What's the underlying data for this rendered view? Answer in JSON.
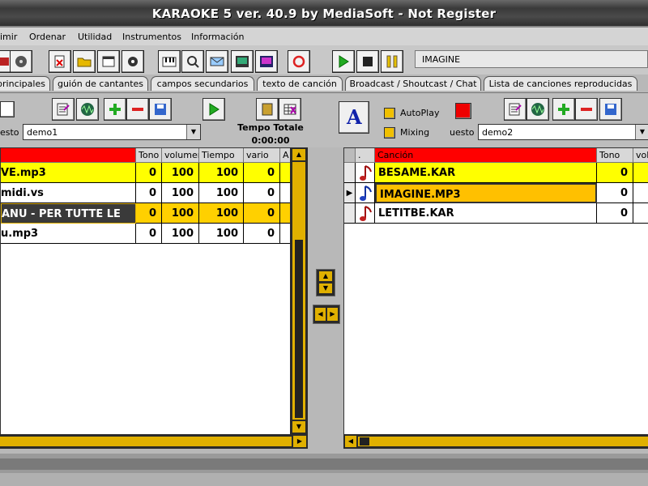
{
  "window": {
    "title": "KARAOKE 5   ver. 40.9 by MediaSoft - Not Register"
  },
  "menu": [
    "imir",
    "Ordenar",
    "Utilidad",
    "Instrumentos",
    "Información"
  ],
  "now_playing": "IMAGINE",
  "tabs": [
    "principales",
    "guión de cantantes",
    "campos secundarios",
    "texto de canción",
    "Broadcast / Shoutcast / Chat",
    "Lista de canciones reproducidas"
  ],
  "left_panel": {
    "combo_label": "esto",
    "combo_value": "demo1",
    "tempo_label": "Tempo Totale",
    "tempo_value": "0:00:00",
    "columns": [
      "",
      "Tono",
      "volumen",
      "Tiempo",
      "vario",
      "A"
    ],
    "rows": [
      {
        "name": "VE.mp3",
        "tono": "0",
        "vol": "100",
        "tiempo": "100",
        "vario": "0",
        "highlight": "yellow"
      },
      {
        "name": "midi.vs",
        "tono": "0",
        "vol": "100",
        "tiempo": "100",
        "vario": "0",
        "highlight": "none"
      },
      {
        "name": "ANU - PER TUTTE LE",
        "tono": "0",
        "vol": "100",
        "tiempo": "100",
        "vario": "0",
        "highlight": "yellow-dark"
      },
      {
        "name": "u.mp3",
        "tono": "0",
        "vol": "100",
        "tiempo": "100",
        "vario": "0",
        "highlight": "none"
      }
    ]
  },
  "right_panel": {
    "autoplay_label": "AutoPlay",
    "mixing_label": "Mixing",
    "combo_label": "uesto",
    "combo_value": "demo2",
    "columns": [
      ".",
      "Canción",
      "Tono",
      "vol"
    ],
    "rows": [
      {
        "name": "BESAME.KAR",
        "tono": "0",
        "highlight": "yellow",
        "current": false
      },
      {
        "name": "IMAGINE.MP3",
        "tono": "0",
        "highlight": "orange",
        "current": true
      },
      {
        "name": "LETITBE.KAR",
        "tono": "0",
        "highlight": "none",
        "current": false
      }
    ]
  },
  "colors": {
    "header_red": "#ff0000",
    "row_yellow": "#ffff00",
    "row_orange": "#ffc000",
    "scroll_gold": "#e0b000",
    "play_green": "#22aa22"
  }
}
